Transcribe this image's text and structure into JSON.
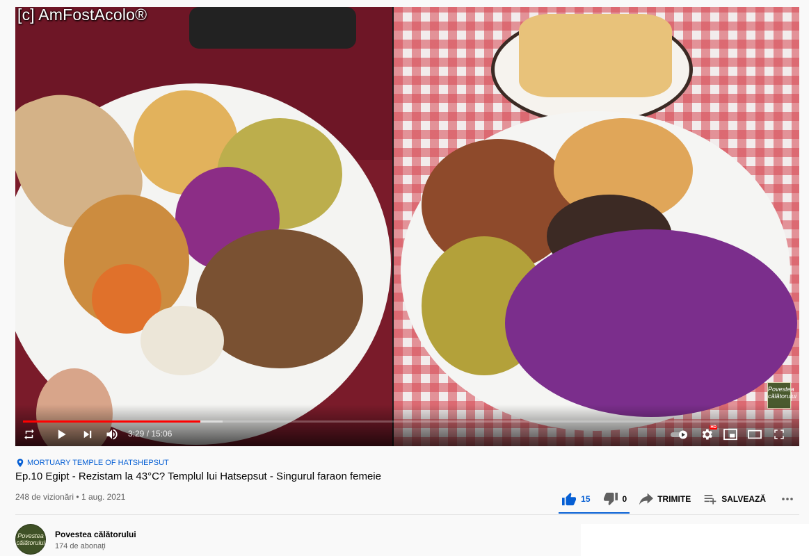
{
  "watermark": "[c] AmFostAcolo®",
  "player": {
    "time_current": "3:29",
    "time_total": "15:06",
    "time_separator": " / ",
    "played_fraction": 0.231,
    "loaded_fraction": 0.26,
    "hd_badge": "HD",
    "channel_badge": "Povestea călătorului",
    "icons": [
      "loop-icon",
      "play-icon",
      "next-icon",
      "volume-icon",
      "autoplay-toggle-icon",
      "settings-icon",
      "miniplayer-icon",
      "theater-icon",
      "fullscreen-icon"
    ]
  },
  "video": {
    "location": "MORTUARY TEMPLE OF HATSHEPSUT",
    "title": "Ep.10 Egipt - Rezistam la 43°C? Templul lui Hatsepsut - Singurul faraon femeie",
    "views": "248 de vizionări",
    "separator": " • ",
    "date": "1 aug. 2021"
  },
  "actions": {
    "likes": "15",
    "dislikes": "0",
    "share_label": "TRIMITE",
    "save_label": "SALVEAZĂ"
  },
  "channel": {
    "name": "Povestea călătorului",
    "subscribers": "174 de abonați",
    "avatar_text": "Povestea călătorului"
  },
  "colors": {
    "accent_blue": "#065fd4",
    "progress_red": "#ff0000"
  }
}
